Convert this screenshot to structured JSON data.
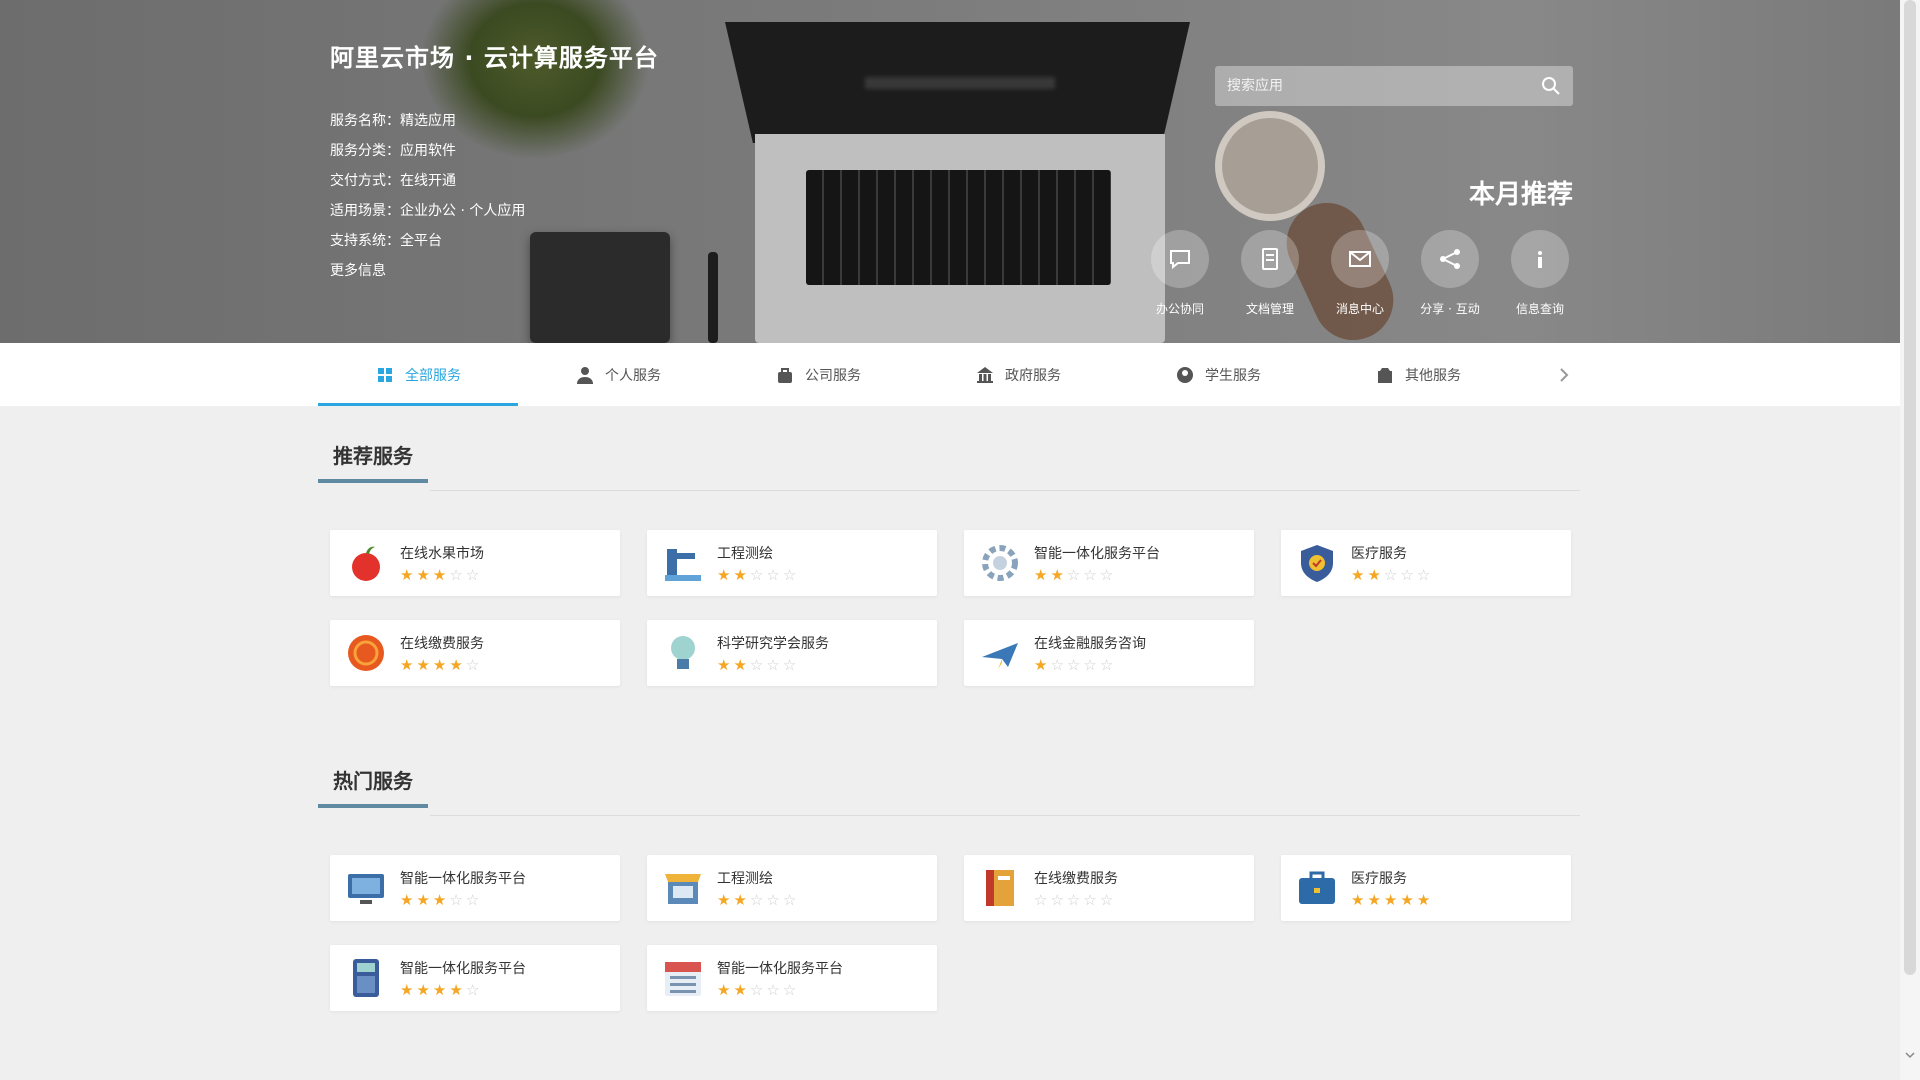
{
  "hero": {
    "site_title": "阿里云市场 · 云计算服务平台",
    "info_lines": [
      "服务名称：精选应用",
      "服务分类：应用软件",
      "交付方式：在线开通",
      "适用场景：企业办公 · 个人应用",
      "支持系统：全平台",
      "更多信息"
    ],
    "search_placeholder": "搜索应用",
    "recommend_title": "本月推荐",
    "quick_links": [
      {
        "label": "办公协同",
        "icon": "chat-icon"
      },
      {
        "label": "文档管理",
        "icon": "document-icon"
      },
      {
        "label": "消息中心",
        "icon": "mail-icon"
      },
      {
        "label": "分享 · 互动",
        "icon": "share-icon"
      },
      {
        "label": "信息查询",
        "icon": "info-icon"
      }
    ]
  },
  "tabs": [
    {
      "label": "全部服务",
      "icon": "grid-icon",
      "active": true
    },
    {
      "label": "个人服务",
      "icon": "person-icon",
      "active": false
    },
    {
      "label": "公司服务",
      "icon": "bag-icon",
      "active": false
    },
    {
      "label": "政府服务",
      "icon": "building-icon",
      "active": false
    },
    {
      "label": "学生服务",
      "icon": "user-icon",
      "active": false
    },
    {
      "label": "其他服务",
      "icon": "box-icon",
      "active": false
    }
  ],
  "sections": [
    {
      "title": "推荐服务",
      "apps": [
        {
          "name": "在线水果市场",
          "icon": "apple-icon",
          "rating": 3
        },
        {
          "name": "工程测绘",
          "icon": "engineering-icon",
          "rating": 2
        },
        {
          "name": "智能一体化服务平台",
          "icon": "gear-icon",
          "rating": 2
        },
        {
          "name": "医疗服务",
          "icon": "shield-icon",
          "rating": 2
        },
        {
          "name": "在线缴费服务",
          "icon": "coin-icon",
          "rating": 4
        },
        {
          "name": "科学研究学会服务",
          "icon": "bulb-icon",
          "rating": 2
        },
        {
          "name": "在线金融服务咨询",
          "icon": "plane-icon",
          "rating": 1
        }
      ]
    },
    {
      "title": "热门服务",
      "apps": [
        {
          "name": "智能一体化服务平台",
          "icon": "monitor-icon",
          "rating": 3
        },
        {
          "name": "工程测绘",
          "icon": "shop-icon",
          "rating": 2
        },
        {
          "name": "在线缴费服务",
          "icon": "book-icon",
          "rating": 0
        },
        {
          "name": "医疗服务",
          "icon": "briefcase-icon",
          "rating": 5
        },
        {
          "name": "智能一体化服务平台",
          "icon": "calculator-icon",
          "rating": 4
        },
        {
          "name": "智能一体化服务平台",
          "icon": "calendar-icon",
          "rating": 2
        }
      ]
    }
  ],
  "colors": {
    "accent": "#2aa6e0",
    "star": "#f5a623",
    "section_underline": "#5f8aa2"
  }
}
